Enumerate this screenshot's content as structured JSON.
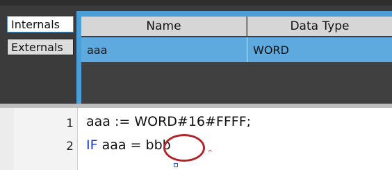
{
  "side_tabs": [
    {
      "label": "Internals",
      "active": true
    },
    {
      "label": "Externals",
      "active": false
    }
  ],
  "variable_table": {
    "columns": [
      "Name",
      "Data Type"
    ],
    "rows": [
      {
        "name": "aaa",
        "data_type": "WORD"
      }
    ]
  },
  "editor": {
    "lines": [
      {
        "number": "1",
        "text": "aaa := WORD#16#FFFF;"
      },
      {
        "number": "2",
        "keyword": "IF",
        "text": " aaa = bbb"
      }
    ]
  },
  "colors": {
    "selection_blue": "#5ea9de",
    "annotation_red": "#b3242c",
    "keyword_blue": "#1a3cc8"
  }
}
